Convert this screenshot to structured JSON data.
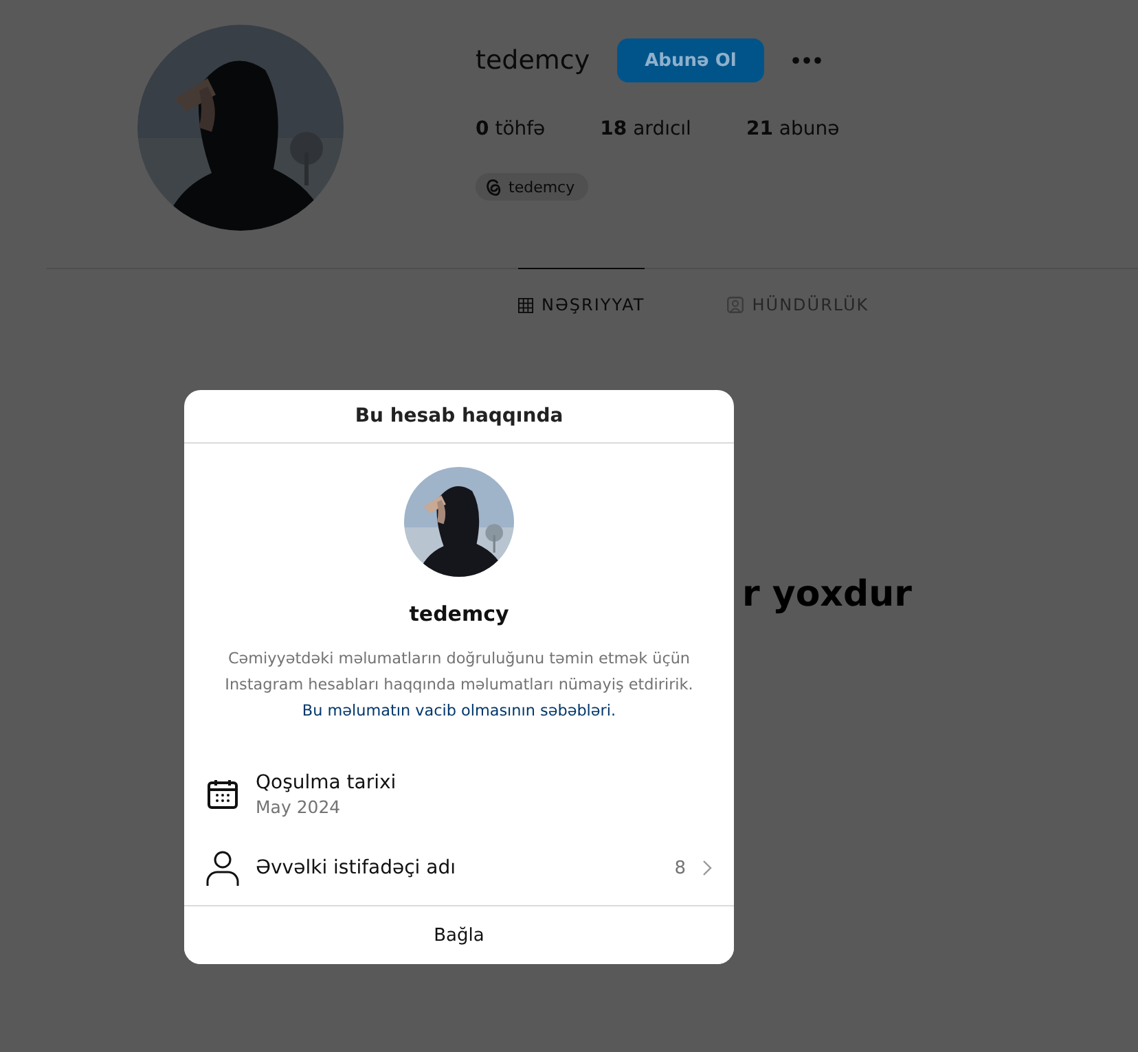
{
  "profile": {
    "username": "tedemcy",
    "follow_button": "Abunə Ol",
    "stats": [
      "**0** töhfə",
      "**18** ardıcıl",
      "**21** abunə"
    ],
    "threads_chip": "tedemcy"
  },
  "tabs": [
    {
      "label": "NƏŞRIYYAT",
      "selected": true,
      "kind": "grid"
    },
    {
      "label": "HÜNDÜRLÜK",
      "selected": false,
      "kind": "tagged"
    }
  ],
  "empty_heading": "r yoxdur",
  "dialog": {
    "title": "Bu hesab haqqında",
    "username": "tedemcy",
    "description": "Cəmiyyətdəki məlumatların doğruluğunu təmin etmək üçün Instagram hesabları haqqında məlumatları nümayiş etdiririk.",
    "link": "Bu məlumatın vacib olmasının səbəbləri.",
    "rows": [
      {
        "kind": "date",
        "label": "Qoşulma tarixi",
        "value": "May 2024"
      },
      {
        "kind": "former",
        "label": "Əvvəlki istifadəçi adı",
        "count": "8"
      }
    ],
    "close": "Bağla"
  }
}
